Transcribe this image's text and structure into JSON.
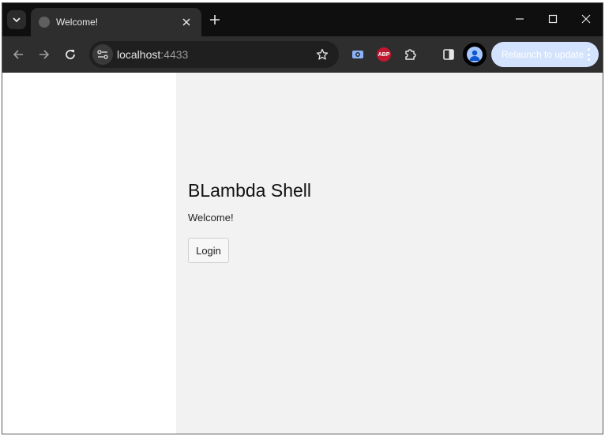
{
  "browser": {
    "tab": {
      "title": "Welcome!"
    },
    "address_bar": {
      "host": "localhost",
      "port": ":4433"
    },
    "relaunch_button": {
      "label": "Relaunch to update"
    },
    "extensions": {
      "abp_label": "ABP"
    }
  },
  "page": {
    "heading": "BLambda Shell",
    "welcome_text": "Welcome!",
    "login_button": "Login"
  },
  "colors": {
    "tabstrip_bg": "#0f0f0f",
    "toolbar_bg": "#2e2e2e",
    "main_bg": "#f2f2f2",
    "relaunch_bg": "#d3e3fd",
    "abp_red": "#c0182f"
  },
  "icons": [
    "tab-search-icon",
    "tab-favicon-icon",
    "close-icon",
    "plus-icon",
    "minimize-icon",
    "maximize-icon",
    "window-close-icon",
    "back-icon",
    "forward-icon",
    "reload-icon",
    "site-info-icon",
    "bookmark-star-icon",
    "screenshot-extension-icon",
    "abp-icon",
    "extensions-puzzle-icon",
    "side-panel-icon",
    "profile-avatar-icon",
    "more-vert-icon"
  ]
}
